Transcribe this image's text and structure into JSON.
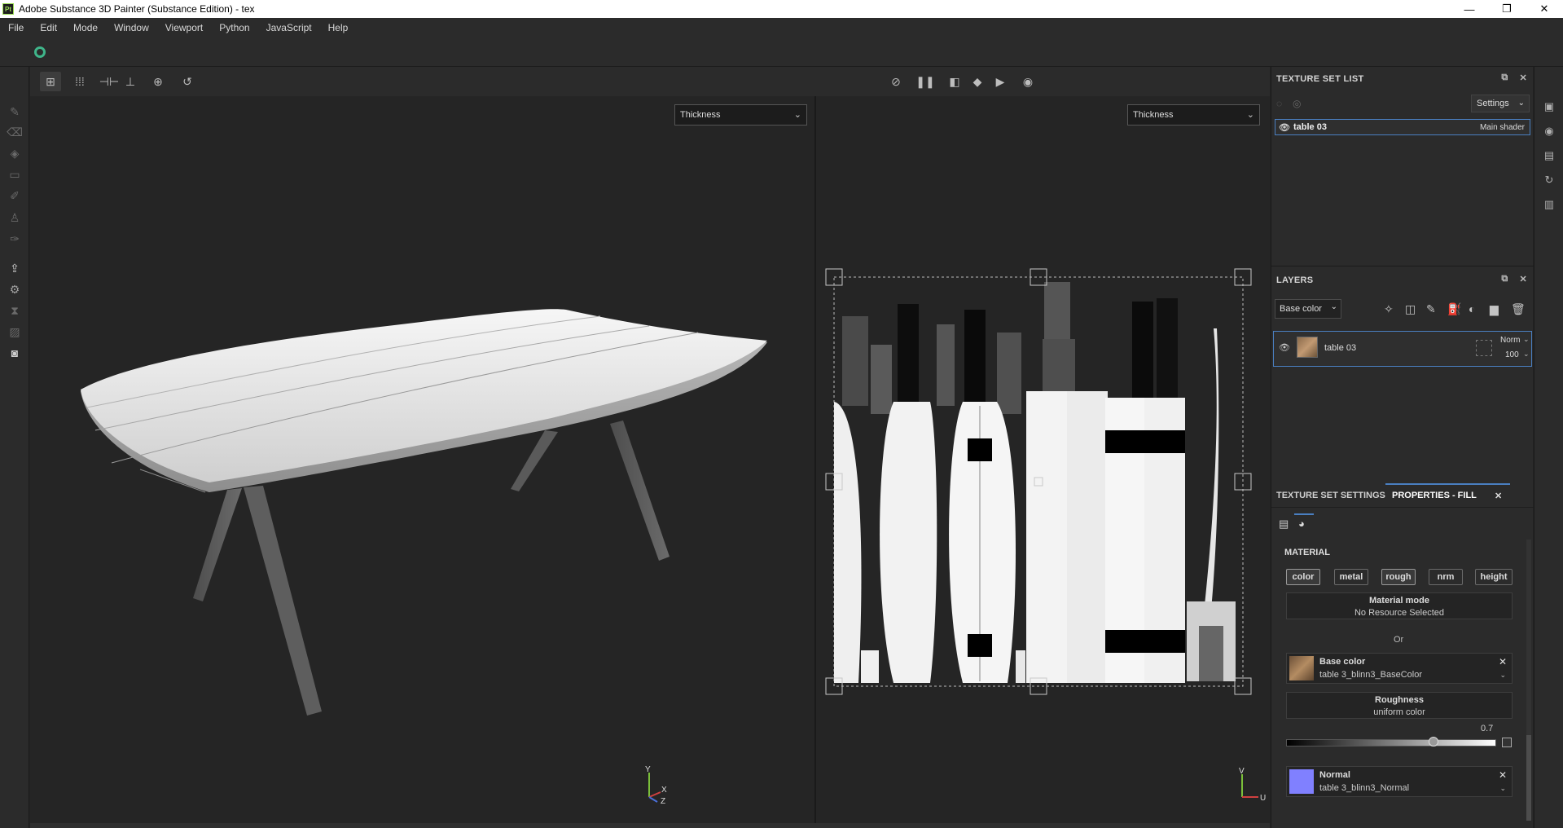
{
  "window": {
    "app_icon_text": "Pt",
    "title": "Adobe Substance 3D Painter (Substance Edition) - tex",
    "controls": [
      "—",
      "❐",
      "✕"
    ]
  },
  "menu": [
    "File",
    "Edit",
    "Mode",
    "Window",
    "Viewport",
    "Python",
    "JavaScript",
    "Help"
  ],
  "viewport": {
    "left_channel": "Thickness",
    "right_channel": "Thickness",
    "axes_3d": {
      "y": "Y",
      "x": "X",
      "z": "Z"
    },
    "axes_2d": {
      "v": "V",
      "u": "U"
    }
  },
  "texture_set_list": {
    "title": "TEXTURE SET LIST",
    "settings_label": "Settings",
    "item_name": "table 03",
    "item_shader": "Main shader"
  },
  "layers": {
    "title": "LAYERS",
    "channel_select": "Base color",
    "layer_name": "table 03",
    "blend_mode": "Norm",
    "opacity": "100"
  },
  "properties": {
    "tab_texture_set_settings": "TEXTURE SET SETTINGS",
    "tab_properties_fill": "PROPERTIES - FILL",
    "section_material": "MATERIAL",
    "material_buttons": [
      "color",
      "metal",
      "rough",
      "nrm",
      "height"
    ],
    "material_mode_label": "Material mode",
    "material_mode_value": "No Resource Selected",
    "or_label": "Or",
    "base_color_title": "Base color",
    "base_color_value": "table 3_blinn3_BaseColor",
    "roughness_title": "Roughness",
    "roughness_value": "uniform color",
    "roughness_number": "0.7",
    "roughness_level": 0.7,
    "normal_title": "Normal",
    "normal_value": "table 3_blinn3_Normal"
  },
  "colors": {
    "accent_blue": "#4a7fc1",
    "normal_swatch": "#8080ff",
    "brand_green": "#3fb58a"
  }
}
